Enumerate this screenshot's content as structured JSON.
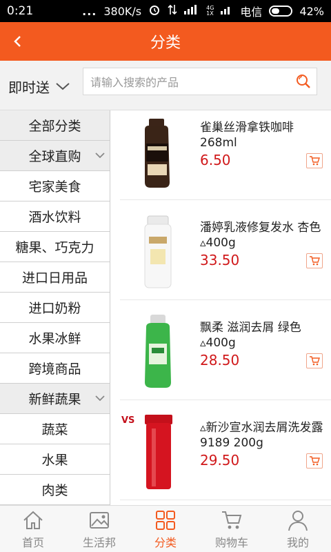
{
  "status_bar": {
    "time": "0:21",
    "dots": "...",
    "speed": "380K/s",
    "network_small": "4G\n1X",
    "carrier": "电信",
    "battery_text": "42%",
    "battery_level": 0.42
  },
  "header": {
    "title": "分类"
  },
  "search": {
    "delivery_label": "即时送",
    "placeholder": "请输入搜索的产品"
  },
  "categories": [
    {
      "label": "全部分类",
      "group": true
    },
    {
      "label": "全球直购",
      "group": true,
      "expandable": true
    },
    {
      "label": "宅家美食"
    },
    {
      "label": "酒水饮料"
    },
    {
      "label": "糖果、巧克力"
    },
    {
      "label": "进口日用品"
    },
    {
      "label": "进口奶粉"
    },
    {
      "label": "水果冰鲜"
    },
    {
      "label": "跨境商品"
    },
    {
      "label": "新鲜蔬果",
      "group": true,
      "expandable": true
    },
    {
      "label": "蔬菜"
    },
    {
      "label": "水果"
    },
    {
      "label": "肉类"
    }
  ],
  "products": [
    {
      "name": "雀巢丝滑拿铁咖啡268ml",
      "price": "6.50",
      "image": "coffee-bottle"
    },
    {
      "name": "潘婷乳液修复发水 杏色▵400g",
      "price": "33.50",
      "image": "shampoo-white"
    },
    {
      "name": "飘柔 滋润去屑 绿色▵400g",
      "price": "28.50",
      "image": "shampoo-green"
    },
    {
      "name": "▵新沙宣水润去屑洗发露9189 200g",
      "price": "29.50",
      "image": "shampoo-red",
      "brand_mark": "VS"
    }
  ],
  "bottom_nav": [
    {
      "label": "首页",
      "icon": "home-icon"
    },
    {
      "label": "生活邦",
      "icon": "image-icon"
    },
    {
      "label": "分类",
      "icon": "grid-icon",
      "active": true
    },
    {
      "label": "购物车",
      "icon": "cart-icon"
    },
    {
      "label": "我的",
      "icon": "user-icon"
    }
  ],
  "colors": {
    "accent": "#f35a1f",
    "price": "#d0181a"
  }
}
